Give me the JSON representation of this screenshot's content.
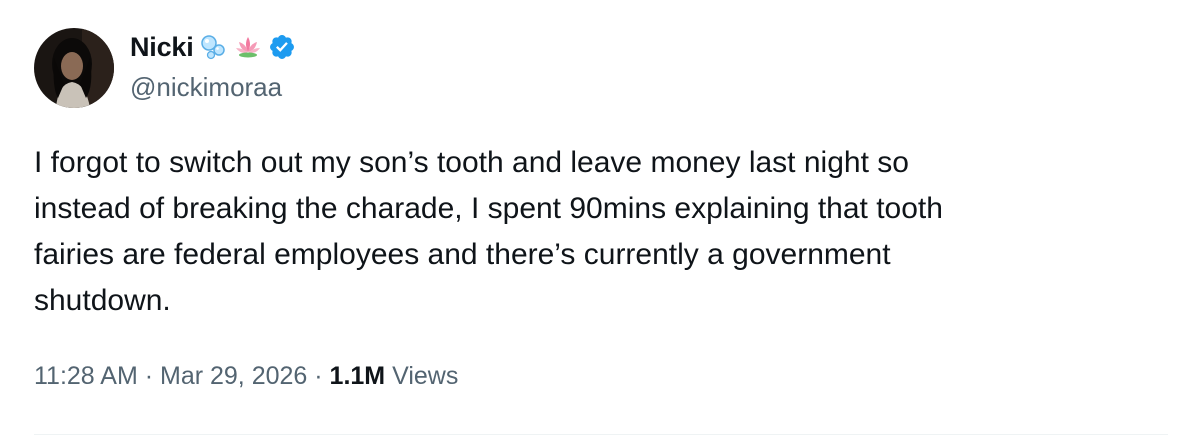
{
  "author": {
    "display_name": "Nicki",
    "handle": "@nickimoraa",
    "verified": true,
    "name_emojis": [
      "bubbles-emoji",
      "lotus-emoji"
    ],
    "verified_badge_color": "#1d9bf0"
  },
  "tweet": {
    "text": "I forgot to switch out my son’s tooth and leave money last night so\ninstead of breaking the charade, I spent 90mins explaining that tooth\nfairies are federal employees and there’s currently a government\nshutdown."
  },
  "meta": {
    "time": "11:28 AM",
    "separator": " · ",
    "date": "Mar 29, 2026",
    "views_count": "1.1M",
    "views_label": "Views"
  },
  "colors": {
    "text_primary": "#0f1419",
    "text_secondary": "#536471",
    "accent": "#1d9bf0",
    "divider": "#eff3f4"
  }
}
